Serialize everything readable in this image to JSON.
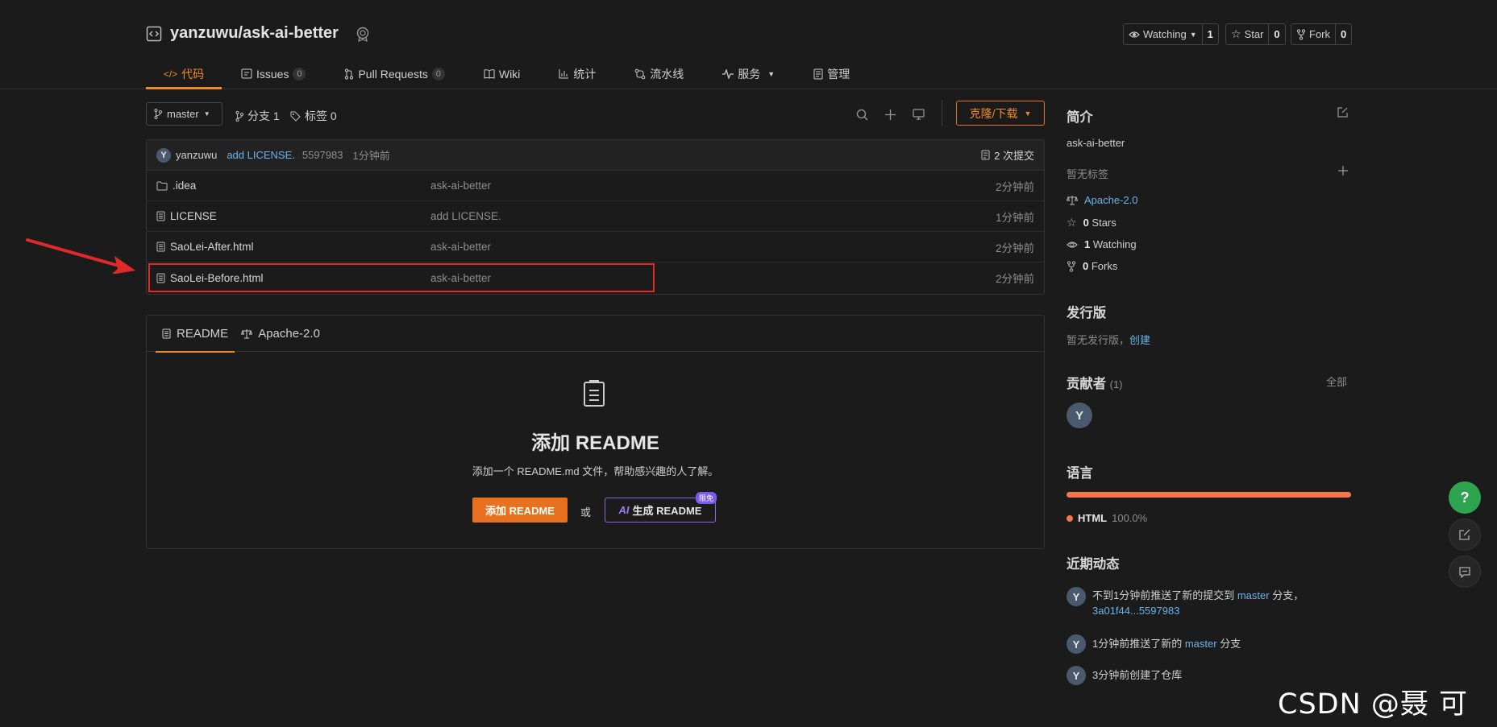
{
  "repo": {
    "path": "yanzuwu/ask-ai-better"
  },
  "header_buttons": {
    "watching": {
      "label": "Watching",
      "count": "1"
    },
    "star": {
      "label": "Star",
      "count": "0"
    },
    "fork": {
      "label": "Fork",
      "count": "0"
    }
  },
  "tabs": [
    {
      "label": "代码",
      "icon": "code-icon",
      "active": true
    },
    {
      "label": "Issues",
      "badge": "0",
      "icon": "issues-icon"
    },
    {
      "label": "Pull Requests",
      "badge": "0",
      "icon": "pull-request-icon"
    },
    {
      "label": "Wiki",
      "icon": "wiki-icon"
    },
    {
      "label": "统计",
      "icon": "stats-icon"
    },
    {
      "label": "流水线",
      "icon": "pipeline-icon"
    },
    {
      "label": "服务",
      "icon": "service-icon"
    },
    {
      "label": "管理",
      "icon": "manage-icon"
    }
  ],
  "branch_bar": {
    "branch": "master",
    "branches_label": "分支 1",
    "tags_label": "标签 0",
    "clone_label": "克隆/下载"
  },
  "commit": {
    "avatar_letter": "Y",
    "author": "yanzuwu",
    "message": "add LICENSE.",
    "hash": "5597983",
    "time": "1分钟前",
    "count_label": "2 次提交"
  },
  "files": [
    {
      "name": ".idea",
      "type": "folder",
      "message": "ask-ai-better",
      "time": "2分钟前"
    },
    {
      "name": "LICENSE",
      "type": "file",
      "message": "add LICENSE.",
      "time": "1分钟前"
    },
    {
      "name": "SaoLei-After.html",
      "type": "file",
      "message": "ask-ai-better",
      "time": "2分钟前"
    },
    {
      "name": "SaoLei-Before.html",
      "type": "file",
      "message": "ask-ai-better",
      "time": "2分钟前"
    }
  ],
  "readme": {
    "tab_readme": "README",
    "tab_license": "Apache-2.0",
    "title": "添加 README",
    "subtitle": "添加一个 README.md 文件，帮助感兴趣的人了解。",
    "add_button": "添加 README",
    "or_text": "或",
    "ai_button": "生成 README",
    "ai_prefix": "AI",
    "ai_badge": "限免"
  },
  "sidebar": {
    "intro_title": "简介",
    "description": "ask-ai-better",
    "no_tags": "暂无标签",
    "license": "Apache-2.0",
    "stars_count": "0",
    "stars_label": "Stars",
    "watching_count": "1",
    "watching_label": "Watching",
    "forks_count": "0",
    "forks_label": "Forks",
    "releases_title": "发行版",
    "no_releases": "暂无发行版，",
    "create_link": "创建",
    "contributors_title": "贡献者",
    "contributors_count": "(1)",
    "all_link": "全部",
    "contributor_letter": "Y",
    "language_title": "语言",
    "language_name": "HTML",
    "language_pct": "100.0%",
    "language_color": "#f4764b",
    "activity_title": "近期动态",
    "activities": [
      {
        "letter": "Y",
        "pre": "不到1分钟前推送了新的提交到 ",
        "branch": "master",
        "mid": " 分支，",
        "link": "3a01f44...5597983"
      },
      {
        "letter": "Y",
        "pre": "1分钟前推送了新的 ",
        "branch": "master",
        "mid": " 分支",
        "link": ""
      },
      {
        "letter": "Y",
        "pre": "3分钟前创建了仓库",
        "branch": "",
        "mid": "",
        "link": ""
      }
    ]
  },
  "watermark": "CSDN @聂 可 以",
  "colors": {
    "accent": "#f08a24",
    "highlight_box": "#e02a2a",
    "arrow": "#e02a2a",
    "help_button": "#2ea44f"
  }
}
